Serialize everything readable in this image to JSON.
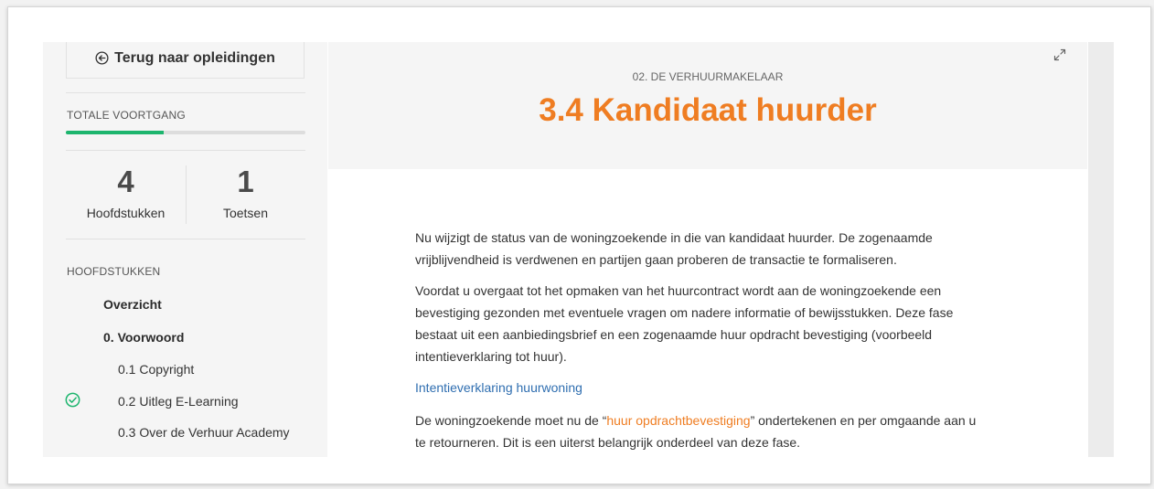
{
  "sidebar": {
    "back_label": "Terug naar opleidingen",
    "progress_label": "TOTALE VOORTGANG",
    "progress_fraction": 0.41,
    "stats": [
      {
        "value": "4",
        "label": "Hoofdstukken"
      },
      {
        "value": "1",
        "label": "Toetsen"
      }
    ],
    "chapters_label": "HOOFDSTUKKEN",
    "items": [
      {
        "label": "Overzicht",
        "bold": true
      },
      {
        "label": "0. Voorwoord",
        "bold": true
      },
      {
        "label": "0.1 Copyright",
        "bold": false
      },
      {
        "label": "0.2 Uitleg E-Learning",
        "bold": false,
        "completed": true
      },
      {
        "label": "0.3 Over de Verhuur Academy",
        "bold": false
      }
    ]
  },
  "header": {
    "chapter": "02. DE VERHUURMAKELAAR",
    "title": "3.4 Kandidaat huurder"
  },
  "content": {
    "p1": "Nu wijzigt de status van de woningzoekende in die van kandidaat huurder. De zogenaamde vrijblijvendheid is verdwenen en partijen gaan proberen de transactie te formaliseren.",
    "p2": "Voordat u overgaat tot het opmaken van het huurcontract wordt aan de woningzoekende een bevestiging gezonden met eventuele vragen om nadere informatie of bewijsstukken. Deze fase bestaat uit een aanbiedingsbrief en een zogenaamde huur opdracht bevestiging (voorbeeld intentieverklaring tot huur).",
    "link": "Intentieverklaring huurwoning",
    "p3_before": "De woningzoekende moet nu de “",
    "p3_link": "huur opdrachtbevestiging",
    "p3_after": "” ondertekenen en per omgaande aan u te retourneren. Dit is een uiterst belangrijk onderdeel van deze fase."
  },
  "colors": {
    "accent": "#ef7d22",
    "progress": "#1db56e",
    "check": "#1db56e",
    "link": "#2f6eb0"
  }
}
